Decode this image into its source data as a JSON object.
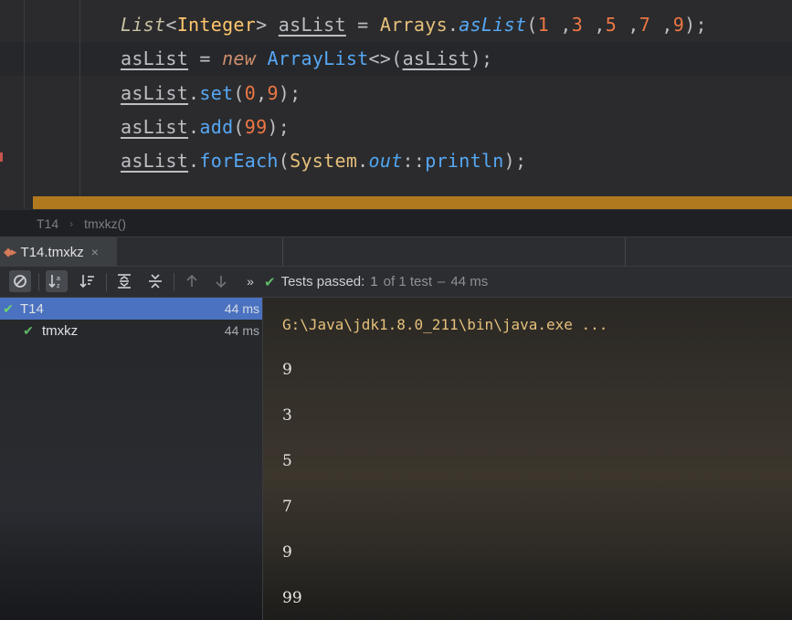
{
  "editor": {
    "lines": [
      {
        "type_list": "List",
        "lt": "<",
        "type_int": "Integer",
        "gt": ">",
        "var": "asList",
        "eq": " = ",
        "cls": "Arrays",
        "dot": ".",
        "fn": "asList",
        "args_open": "(",
        "args": [
          "1",
          " ,",
          "3",
          " ,",
          "5",
          " ,",
          "7",
          " ,",
          "9"
        ],
        "args_close": ");"
      },
      {
        "var": "asList",
        "eq": " = ",
        "kw": "new",
        "cls": "ArrayList",
        "diamond": "<>",
        "paren_open": "(",
        "arg": "asList",
        "close": ");"
      },
      {
        "var": "asList",
        "dot": ".",
        "fn": "set",
        "open": "(",
        "a1": "0",
        "comma": ",",
        "a2": "9",
        "close": ");"
      },
      {
        "var": "asList",
        "dot": ".",
        "fn": "add",
        "open": "(",
        "a1": "99",
        "close": ");"
      },
      {
        "var": "asList",
        "dot": ".",
        "fn": "forEach",
        "open": "(",
        "cls": "System",
        "dot2": ".",
        "field": "out",
        "ref": "::",
        "method": "println",
        "close": ");"
      }
    ]
  },
  "breadcrumb": {
    "class_name": "T14",
    "separator": "›",
    "method_name": "tmxkz()"
  },
  "run_tab": {
    "icon": "run-config-icon",
    "label": "T14.tmxkz",
    "close": "×"
  },
  "toolbar": {
    "buttons": [
      "stop-icon",
      "sort-alpha-icon",
      "sort-duration-icon",
      "expand-all-icon",
      "collapse-all-icon",
      "prev-failed-icon",
      "next-failed-icon",
      "more-icon"
    ],
    "more_glyph": "»",
    "status": {
      "prefix": "Tests passed:",
      "passed": "1",
      "of": "of 1 test",
      "dash": "–",
      "time": "44 ms"
    }
  },
  "tree": {
    "items": [
      {
        "name": "T14",
        "time": "44 ms",
        "selected": true
      },
      {
        "name": "tmxkz",
        "time": "44 ms",
        "selected": false
      }
    ]
  },
  "console": {
    "command": "G:\\Java\\jdk1.8.0_211\\bin\\java.exe ...",
    "output": [
      "9",
      "3",
      "5",
      "7",
      "9",
      "99"
    ]
  },
  "colors": {
    "pass_green": "#5fb865",
    "selection_blue": "#4a72c0",
    "progress_orange": "#b1791d",
    "console_cmd": "#e5c07b"
  }
}
